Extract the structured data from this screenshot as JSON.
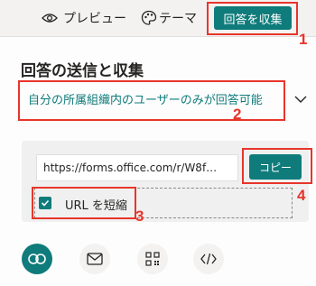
{
  "topbar": {
    "preview_label": "プレビュー",
    "theme_label": "テーマ",
    "collect_button_label": "回答を収集"
  },
  "panel": {
    "title": "回答の送信と収集",
    "scope_option": "自分の所属組織内のユーザーのみが回答可能",
    "link_url": "https://forms.office.com/r/W8f…",
    "copy_button_label": "コピー",
    "shorten_url_label": "URL を短縮",
    "shorten_url_checked": true
  },
  "share_methods": [
    {
      "icon": "link-icon",
      "selected": true
    },
    {
      "icon": "mail-icon",
      "selected": false
    },
    {
      "icon": "qr-code-icon",
      "selected": false
    },
    {
      "icon": "embed-code-icon",
      "selected": false
    }
  ],
  "annotations": [
    "1",
    "2",
    "3",
    "4"
  ],
  "colors": {
    "accent": "#0f7b7b",
    "annotation": "#e8352b"
  }
}
